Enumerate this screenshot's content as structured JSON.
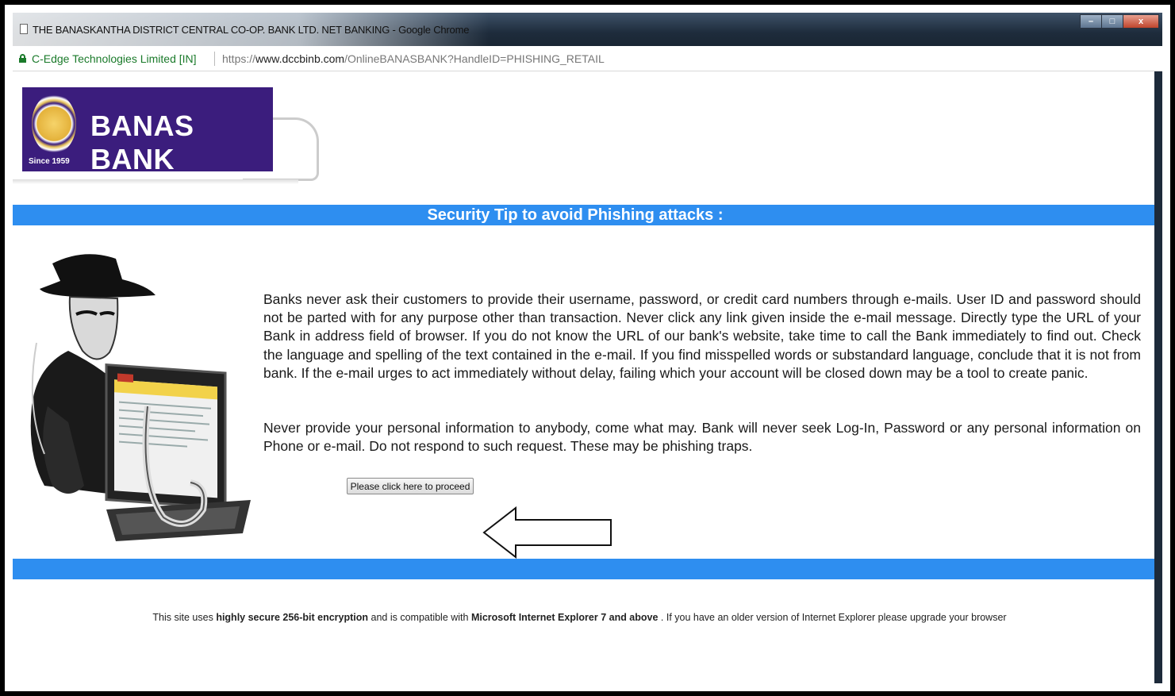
{
  "window": {
    "title": "THE BANASKANTHA DISTRICT CENTRAL CO-OP. BANK LTD. NET BANKING - Google Chrome",
    "controls": {
      "minimize": "–",
      "maximize": "□",
      "close": "x"
    }
  },
  "addressbar": {
    "certificate": "C-Edge Technologies Limited [IN]",
    "url_scheme": "https://",
    "url_host": "www.dccbinb.com",
    "url_path": "/OnlineBANASBANK?HandleID=PHISHING_RETAIL"
  },
  "logo": {
    "brand": "BANAS BANK",
    "since": "Since 1959"
  },
  "colors": {
    "accent_bar": "#2e8ef0",
    "logo_bg": "#3b1d7d"
  },
  "section": {
    "title": "Security Tip to avoid Phishing attacks :"
  },
  "content": {
    "paragraph1": "Banks never ask their customers to provide their username, password, or credit card numbers through e-mails. User ID and password should not be parted with for any purpose other than transaction. Never click any link given inside the e-mail message. Directly type the URL of your Bank in address field of browser. If you do not know the URL of our bank's website, take time to call the Bank immediately to find out. Check the language and spelling of the text contained in the e-mail. If you find misspelled words or substandard language, conclude that it is not from bank. If the e-mail urges to act immediately without delay, failing which your account will be closed down may be a tool to create panic.",
    "paragraph2": "Never provide your personal information to anybody, come what may. Bank will never seek Log-In, Password or any personal information on Phone or e-mail. Do not respond to such request. These may be phishing traps.",
    "proceed_button": "Please click here to proceed"
  },
  "footer": {
    "part1": "This site uses ",
    "bold1": "highly secure 256-bit encryption",
    "part2": " and is compatible with ",
    "bold2": "Microsoft Internet Explorer 7 and above",
    "part3": " . If you have an older version of Internet Explorer please upgrade your browser"
  }
}
